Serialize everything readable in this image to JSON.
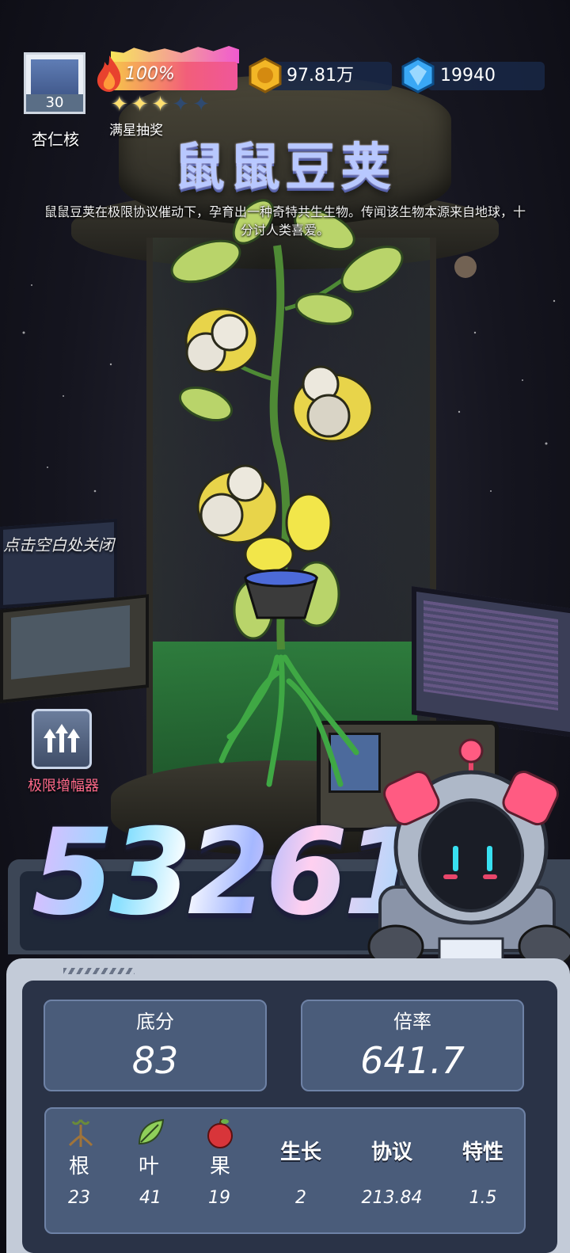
{
  "player": {
    "level": "30",
    "name": "杏仁核"
  },
  "energy": {
    "percent_text": "100%",
    "percent": 100
  },
  "stars": {
    "filled": 3,
    "total": 5,
    "label": "满星抽奖"
  },
  "resources": {
    "gold": "97.81万",
    "gems": "19940"
  },
  "plant": {
    "title": "鼠鼠豆荚",
    "description": "鼠鼠豆荚在极限协议催动下，孕育出一种奇特共生生物。传闻该生物本源来自地球，十分讨人类喜爱。"
  },
  "hints": {
    "close": "点击空白处关闭"
  },
  "amplifier": {
    "label": "极限增幅器",
    "icon": "up-arrows-icon"
  },
  "score": {
    "total": "53261"
  },
  "stats": {
    "base_label": "底分",
    "base_value": "83",
    "multiplier_label": "倍率",
    "multiplier_value": "641.7",
    "columns": [
      {
        "label": "根",
        "value": "23",
        "icon": "root-icon"
      },
      {
        "label": "叶",
        "value": "41",
        "icon": "leaf-icon"
      },
      {
        "label": "果",
        "value": "19",
        "icon": "fruit-icon"
      },
      {
        "label": "生长",
        "value": "2"
      },
      {
        "label": "协议",
        "value": "213.84"
      },
      {
        "label": "特性",
        "value": "1.5"
      }
    ]
  },
  "colors": {
    "accent_pink": "#ff6a8a",
    "panel_blue": "#4a5c7a",
    "gold": "#f3b626",
    "gem": "#3aa8f5"
  }
}
